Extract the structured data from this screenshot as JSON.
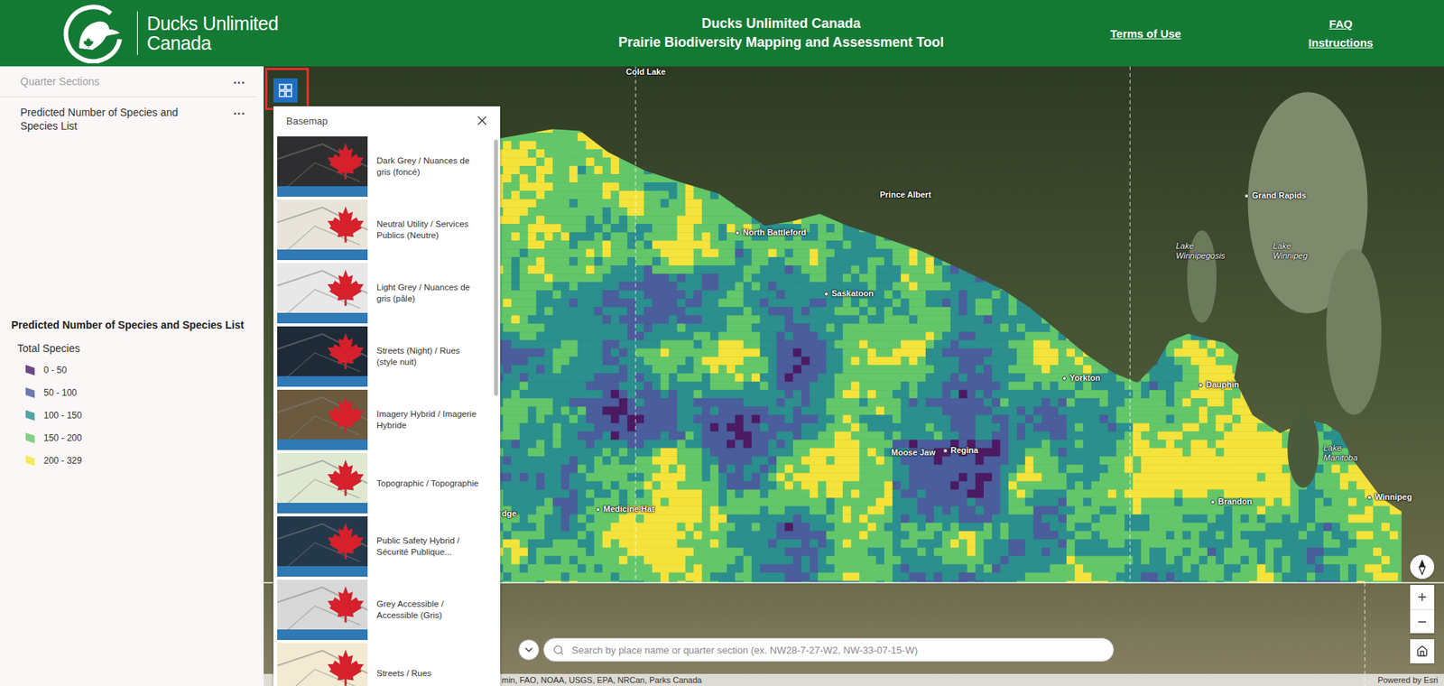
{
  "header": {
    "logo": {
      "line1": "Ducks Unlimited",
      "line2": "Canada"
    },
    "title": [
      "Ducks Unlimited Canada",
      "Prairie Biodiversity Mapping and Assessment Tool"
    ],
    "links": [
      {
        "label": "Terms of Use"
      },
      {
        "label": "FAQ"
      },
      {
        "label": "Instructions"
      }
    ]
  },
  "sidebar": {
    "layers": [
      {
        "label": "Quarter Sections",
        "menu": "...",
        "disabled": true
      },
      {
        "label": "Predicted Number of Species and Species List",
        "menu": "...",
        "disabled": false
      }
    ],
    "legend": {
      "title": "Predicted Number of Species and Species List",
      "subtitle": "Total Species",
      "items": [
        {
          "label": "0 - 50",
          "color": "#4b1a63"
        },
        {
          "label": "50 - 100",
          "color": "#4a5d9c"
        },
        {
          "label": "100 - 150",
          "color": "#2b8f8e"
        },
        {
          "label": "150 - 200",
          "color": "#63c76a"
        },
        {
          "label": "200 - 329",
          "color": "#f5e33b"
        }
      ]
    }
  },
  "basemap_toggle": {
    "highlighted": true
  },
  "basemap_panel": {
    "title": "Basemap",
    "items": [
      {
        "label": "Dark Grey / Nuances de gris (foncé)",
        "color": "#2e2e30"
      },
      {
        "label": "Neutral Utility / Services Publics (Neutre)",
        "color": "#e9e4da"
      },
      {
        "label": "Light Grey / Nuances de gris (pâle)",
        "color": "#e8e8e8"
      },
      {
        "label": "Streets (Night) / Rues (style nuit)",
        "color": "#1f2a38"
      },
      {
        "label": "Imagery Hybrid / Imagerie Hybride",
        "color": "#6b5a3e"
      },
      {
        "label": "Topographic / Topographie",
        "color": "#dfe9d2"
      },
      {
        "label": "Public Safety Hybrid / Sécurité Publique...",
        "color": "#24384a"
      },
      {
        "label": "Grey Accessible / Accessible (Gris)",
        "color": "#d8d8d8"
      },
      {
        "label": "Streets / Rues",
        "color": "#f2ead2"
      }
    ]
  },
  "map_labels": [
    {
      "label": "Cold Lake",
      "kind": "place"
    },
    {
      "label": "Prince Albert",
      "kind": "place"
    },
    {
      "label": "Grand Rapids",
      "kind": "city"
    },
    {
      "label": "North Battleford",
      "kind": "city"
    },
    {
      "label": "Lake Winnipegosis",
      "kind": "lake"
    },
    {
      "label": "Lake Winnipeg",
      "kind": "lake"
    },
    {
      "label": "Saskatoon",
      "kind": "city"
    },
    {
      "label": "Yorkton",
      "kind": "city"
    },
    {
      "label": "Dauphin",
      "kind": "city"
    },
    {
      "label": "Moose Jaw",
      "kind": "place"
    },
    {
      "label": "Regina",
      "kind": "city"
    },
    {
      "label": "Medicine Hat",
      "kind": "city"
    },
    {
      "label": "Lake Manitoba",
      "kind": "lake"
    },
    {
      "label": "Brandon",
      "kind": "city"
    },
    {
      "label": "Winnipeg",
      "kind": "city"
    },
    {
      "label": "dge",
      "kind": "cut"
    }
  ],
  "search": {
    "placeholder": "Search by place name or quarter section (ex. NW28-7-27-W2, NW-33-07-15-W)"
  },
  "attribution": {
    "sources": "min, FAO, NOAA, USGS, EPA, NRCan, Parks Canada",
    "powered": "Powered by Esri"
  }
}
